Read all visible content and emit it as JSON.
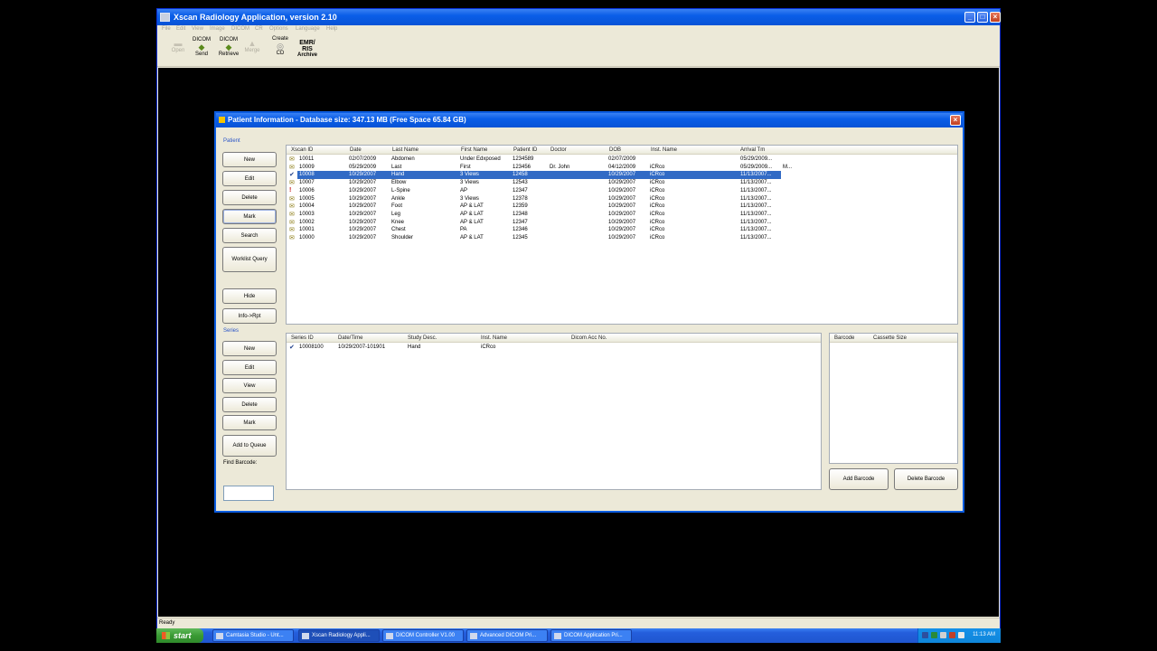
{
  "main_window": {
    "title": "Xscan Radiology Application, version 2.10",
    "menu": [
      "File",
      "Edit",
      "View",
      "Image",
      "DICOM",
      "CR",
      "Options",
      "Language",
      "Help"
    ],
    "toolbar": {
      "open": "Open",
      "dicom_send_top": "DICOM",
      "dicom_send_bottom": "Send",
      "dicom_retrieve_top": "DICOM",
      "dicom_retrieve_bottom": "Retrieve",
      "merge": "Merge",
      "create_cd_top": "Create",
      "create_cd_bottom": "CD",
      "emr_line1": "EMR/",
      "emr_line2": "RIS",
      "emr_line3": "Archive"
    },
    "status": "Ready"
  },
  "dialog": {
    "title": "Patient Information  - Database size: 347.13 MB (Free Space 65.84 GB)",
    "patient_group_label": "Patient",
    "patient_buttons": {
      "new": "New",
      "edit": "Edit",
      "delete": "Delete",
      "mark": "Mark",
      "search": "Search",
      "worklist": "Worklist Query",
      "hide": "Hide",
      "info_rpt": "Info->Rpt"
    },
    "series_group_label": "Series",
    "series_buttons": {
      "new": "New",
      "edit": "Edit",
      "view": "View",
      "delete": "Delete",
      "mark": "Mark",
      "add_queue": "Add to Queue"
    },
    "find_barcode_label": "Find Barcode:",
    "find_barcode_value": "",
    "patient_columns": [
      "Xscan ID",
      "Date",
      "Last Name",
      "First Name",
      "Patient ID",
      "Doctor",
      "DOB",
      "Inst. Name",
      "Arrival Tm"
    ],
    "patients": [
      {
        "icon": "envelope",
        "id": "10011",
        "date": "02/07/2009",
        "last": "Abdomen",
        "first": "Under Edxposed",
        "pid": "1234589",
        "doctor": "",
        "dob": "02/07/2009",
        "inst": "",
        "arrival": "05/29/2009...",
        "extra": ""
      },
      {
        "icon": "envelope",
        "id": "10009",
        "date": "05/29/2009",
        "last": "Last",
        "first": "First",
        "pid": "123456",
        "doctor": "Dr. John",
        "dob": "04/12/2009",
        "inst": "iCRco",
        "arrival": "05/29/2009...",
        "extra": "M..."
      },
      {
        "icon": "check",
        "id": "10008",
        "date": "10/29/2007",
        "last": "Hand",
        "first": "3 Views",
        "pid": "12458",
        "doctor": "",
        "dob": "10/29/2007",
        "inst": "iCRco",
        "arrival": "11/13/2007...",
        "extra": "",
        "selected": true
      },
      {
        "icon": "envelope",
        "id": "10007",
        "date": "10/29/2007",
        "last": "Elbow",
        "first": "3 Views",
        "pid": "12543",
        "doctor": "",
        "dob": "10/29/2007",
        "inst": "iCRco",
        "arrival": "11/13/2007...",
        "extra": ""
      },
      {
        "icon": "exclamation",
        "id": "10006",
        "date": "10/29/2007",
        "last": "L-Spine",
        "first": "AP",
        "pid": "12347",
        "doctor": "",
        "dob": "10/29/2007",
        "inst": "iCRco",
        "arrival": "11/13/2007...",
        "extra": ""
      },
      {
        "icon": "envelope",
        "id": "10005",
        "date": "10/29/2007",
        "last": "Ankle",
        "first": "3 Views",
        "pid": "12378",
        "doctor": "",
        "dob": "10/29/2007",
        "inst": "iCRco",
        "arrival": "11/13/2007...",
        "extra": ""
      },
      {
        "icon": "envelope",
        "id": "10004",
        "date": "10/29/2007",
        "last": "Foot",
        "first": "AP & LAT",
        "pid": "12359",
        "doctor": "",
        "dob": "10/29/2007",
        "inst": "iCRco",
        "arrival": "11/13/2007...",
        "extra": ""
      },
      {
        "icon": "envelope",
        "id": "10003",
        "date": "10/29/2007",
        "last": "Leg",
        "first": "AP & LAT",
        "pid": "12348",
        "doctor": "",
        "dob": "10/29/2007",
        "inst": "iCRco",
        "arrival": "11/13/2007...",
        "extra": ""
      },
      {
        "icon": "envelope",
        "id": "10002",
        "date": "10/29/2007",
        "last": "Knee",
        "first": "AP & LAT",
        "pid": "12347",
        "doctor": "",
        "dob": "10/29/2007",
        "inst": "iCRco",
        "arrival": "11/13/2007...",
        "extra": ""
      },
      {
        "icon": "envelope",
        "id": "10001",
        "date": "10/29/2007",
        "last": "Chest",
        "first": "PA",
        "pid": "12346",
        "doctor": "",
        "dob": "10/29/2007",
        "inst": "iCRco",
        "arrival": "11/13/2007...",
        "extra": ""
      },
      {
        "icon": "envelope",
        "id": "10000",
        "date": "10/29/2007",
        "last": "Shoulder",
        "first": "AP & LAT",
        "pid": "12345",
        "doctor": "",
        "dob": "10/29/2007",
        "inst": "iCRco",
        "arrival": "11/13/2007...",
        "extra": ""
      }
    ],
    "series_columns": [
      "Series ID",
      "Date/Time",
      "Study Desc.",
      "Inst. Name",
      "Dicom Acc No."
    ],
    "series": [
      {
        "id": "10008100",
        "datetime": "10/29/2007-101901",
        "desc": "Hand",
        "inst": "iCRco",
        "acc": ""
      }
    ],
    "barcode_columns": [
      "Barcode",
      "Cassette Size"
    ],
    "add_barcode": "Add Barcode",
    "delete_barcode": "Delete Barcode"
  },
  "taskbar": {
    "start": "start",
    "tasks": [
      "Camtasia Studio - Unt...",
      "Xscan Radiology Appli...",
      "DICOM Controller V1.00",
      "Advanced DICOM Pri...",
      "DICOM Application Pri..."
    ],
    "clock": "11:13 AM"
  }
}
